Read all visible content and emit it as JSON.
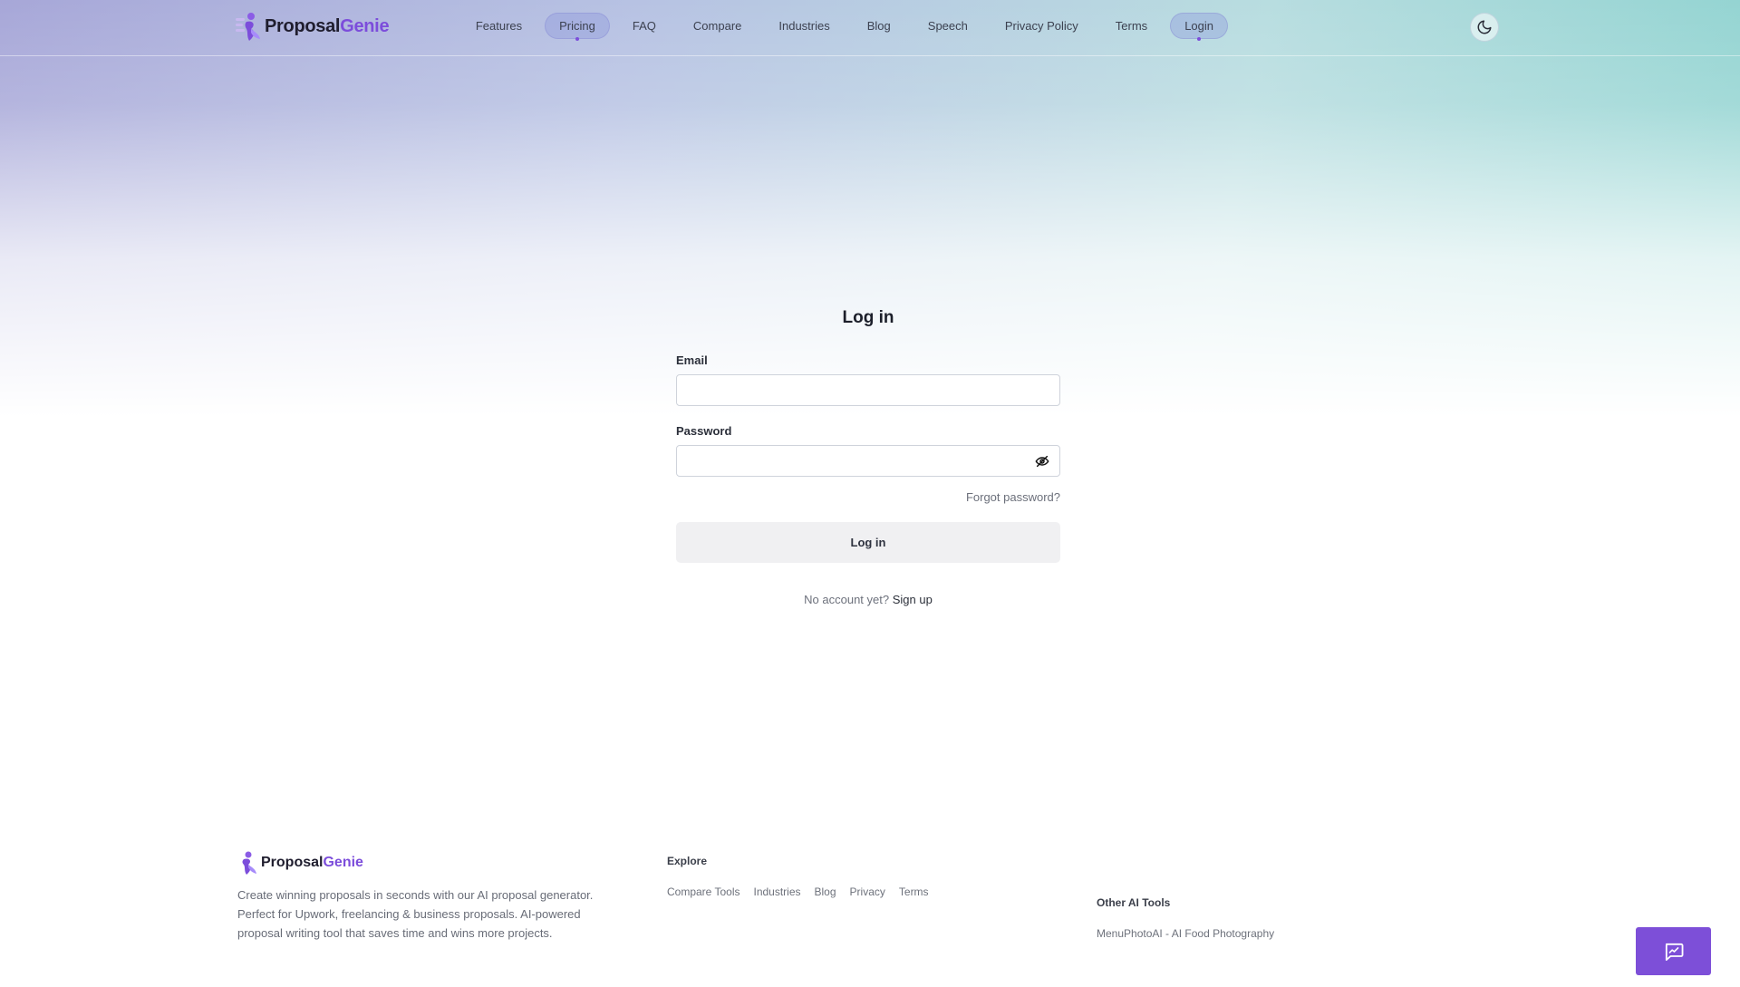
{
  "brand": {
    "name_part1": "Proposal",
    "name_part2": "Genie",
    "accent_color": "#7c4ddb",
    "logo_icon": "genie-logo-icon"
  },
  "nav": {
    "items": [
      {
        "label": "Features",
        "active": false
      },
      {
        "label": "Pricing",
        "active": true
      },
      {
        "label": "FAQ",
        "active": false
      },
      {
        "label": "Compare",
        "active": false
      },
      {
        "label": "Industries",
        "active": false
      },
      {
        "label": "Blog",
        "active": false
      },
      {
        "label": "Speech",
        "active": false
      },
      {
        "label": "Privacy Policy",
        "active": false
      },
      {
        "label": "Terms",
        "active": false
      },
      {
        "label": "Login",
        "active": true
      }
    ],
    "theme_toggle_icon": "moon-icon"
  },
  "login": {
    "title": "Log in",
    "email_label": "Email",
    "email_value": "",
    "password_label": "Password",
    "password_value": "",
    "password_toggle_icon": "eye-off-icon",
    "forgot_password": "Forgot password?",
    "submit_label": "Log in",
    "no_account_text": "No account yet?",
    "signup_link": "Sign up"
  },
  "footer": {
    "brand_part1": "Proposal",
    "brand_part2": "Genie",
    "description": "Create winning proposals in seconds with our AI proposal generator. Perfect for Upwork, freelancing & business proposals. AI-powered proposal writing tool that saves time and wins more projects.",
    "explore_title": "Explore",
    "explore_links": [
      "Compare Tools",
      "Industries",
      "Blog",
      "Privacy",
      "Terms"
    ],
    "other_tools_title": "Other AI Tools",
    "other_tools_links": [
      "MenuPhotoAI - AI Food Photography"
    ]
  },
  "chat": {
    "icon": "chat-message-icon",
    "color": "#7d4fd8"
  }
}
